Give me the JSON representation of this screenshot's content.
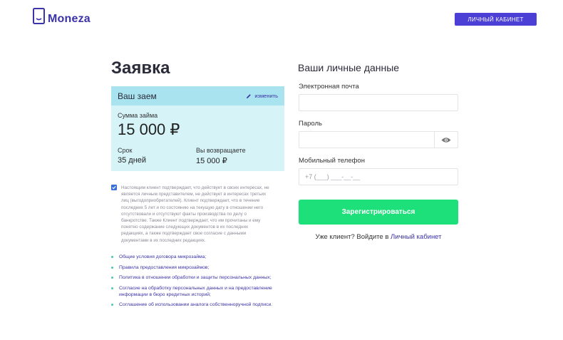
{
  "header": {
    "logo_text": "Moneza",
    "cabinet_button": "ЛИЧНЫЙ КАБИНЕТ"
  },
  "page_title": "Заявка",
  "loan": {
    "header_title": "Ваш заем",
    "edit_label": "изменить",
    "amount_label": "Сумма займа",
    "amount_value": "15 000 ₽",
    "term_label": "Срок",
    "term_value": "35 дней",
    "return_label": "Вы возвращаете",
    "return_value": "15 000 ₽"
  },
  "consent": {
    "checked": true,
    "text": "Настоящим клиент подтверждает, что действует в своих интересах, не является личным представителем, не действует в интересах третьих лиц (выгодоприобретателей). Клиент подтверждает, что в течение последних 5 лет и по состоянию на текущую дату в отношении него отсутствовали и отсутствуют факты производства по делу о банкротстве. Также Клиент подтверждает, что им прочитаны и ему понятно содержание следующих документов в их последних редакциях, а также подтверждает свое согласие с данными документами в их последних редакциях."
  },
  "documents": [
    "Общие условия договора микрозайма;",
    "Правила предоставления микрозаймов;",
    "Политика в отношении обработки и защиты персональных данных;",
    "Согласие на обработку персональных данных и на предоставление информации в бюро кредитных историй;",
    "Соглашение об использовании аналога собственноручной подписи."
  ],
  "form": {
    "title": "Ваши личные данные",
    "email_label": "Электронная почта",
    "email_value": "",
    "password_label": "Пароль",
    "password_value": "",
    "phone_label": "Мобильный телефон",
    "phone_placeholder": "+7 (___) ___-__-__",
    "register_button": "Зарегистрироваться",
    "login_prompt": "Уже клиент? Войдите в",
    "login_link": "Личный кабинет"
  },
  "colors": {
    "brand": "#3b33a8",
    "button_primary": "#4b3fd6",
    "register_green": "#1ee07a",
    "card_bg": "#d6f3f8",
    "card_header": "#a9e3ef"
  },
  "icons": [
    "phone-logo-icon",
    "pencil-icon",
    "eye-icon",
    "check-icon",
    "bullet-icon"
  ]
}
